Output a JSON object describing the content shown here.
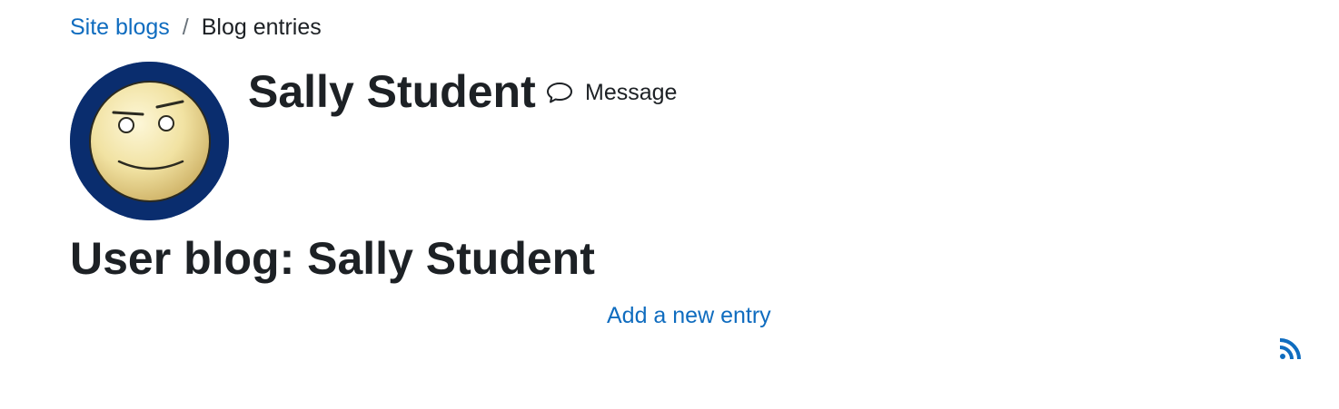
{
  "breadcrumb": {
    "items": [
      {
        "label": "Site blogs"
      },
      {
        "label": "Blog entries"
      }
    ],
    "separator": "/"
  },
  "profile": {
    "name": "Sally Student",
    "avatar_icon": "smiley-avatar",
    "message_label": "Message",
    "message_icon": "speech-bubble-icon"
  },
  "blog": {
    "heading": "User blog: Sally Student",
    "add_entry_label": "Add a new entry",
    "rss_icon": "rss-icon"
  },
  "colors": {
    "link": "#0f6cbf",
    "text": "#1d2125",
    "avatar_ring": "#0a2d6e"
  }
}
